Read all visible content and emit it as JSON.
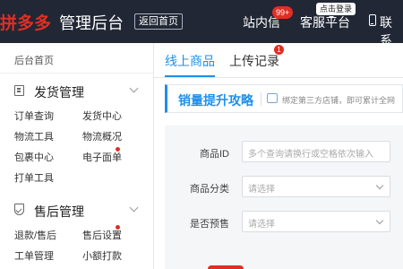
{
  "header": {
    "logo": "拼多多",
    "title": "管理后台",
    "home_button": "返回首页",
    "messages": "站内信",
    "messages_badge": "99+",
    "service": "客服平台",
    "service_tip": "点击登录",
    "contact": "联系"
  },
  "sidebar": {
    "home": "后台首页",
    "sections": [
      {
        "title": "发货管理",
        "icon": "document-icon",
        "links": [
          "订单查询",
          "发货中心",
          "物流工具",
          "物流概况",
          "包裹中心",
          "电子面单",
          "打单工具"
        ]
      },
      {
        "title": "售后管理",
        "icon": "shield-check-icon",
        "links": [
          "退款/售后",
          "售后设置",
          "工单管理",
          "小额打款"
        ]
      }
    ]
  },
  "main": {
    "tabs": [
      {
        "label": "线上商品",
        "active": true
      },
      {
        "label": "上传记录",
        "badge": "1"
      }
    ],
    "promo": {
      "title": "销量提升攻略",
      "text": "绑定第三方店铺，即可累计全网"
    },
    "form": {
      "fields": [
        {
          "label": "商品ID",
          "placeholder": "多个查询请换行或空格依次输入",
          "type": "input"
        },
        {
          "label": "商品分类",
          "placeholder": "请选择",
          "type": "select"
        },
        {
          "label": "是否预售",
          "placeholder": "请选择",
          "type": "select"
        }
      ]
    }
  },
  "colors": {
    "header_bg": "#212735",
    "brand_red": "#e02e24",
    "accent_blue": "#1f8fea"
  }
}
